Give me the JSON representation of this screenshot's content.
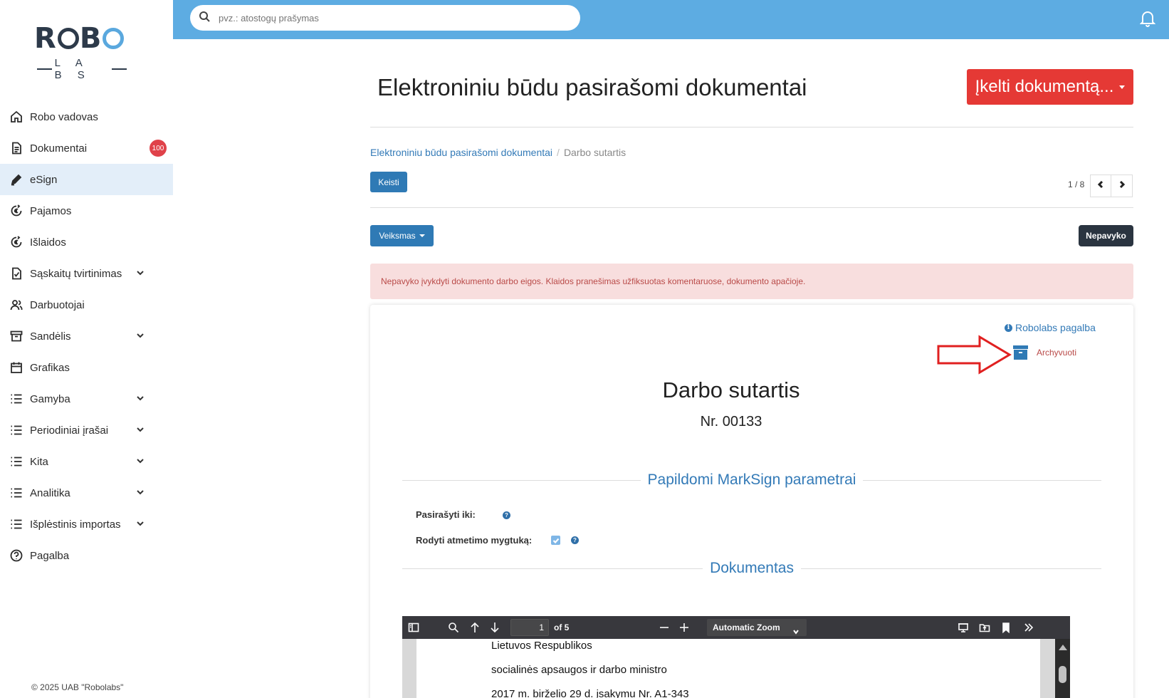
{
  "logo": {
    "top": "ROBO",
    "bottom": "LABS"
  },
  "sidebar": {
    "items": [
      {
        "label": "Robo vadovas",
        "icon": "home-icon"
      },
      {
        "label": "Dokumentai",
        "icon": "document-icon",
        "badge": "100"
      },
      {
        "label": "eSign",
        "icon": "pen-icon",
        "active": true
      },
      {
        "label": "Pajamos",
        "icon": "income-icon"
      },
      {
        "label": "Išlaidos",
        "icon": "expenses-icon"
      },
      {
        "label": "Sąskaitų tvirtinimas",
        "icon": "invoice-check-icon",
        "expandable": true
      },
      {
        "label": "Darbuotojai",
        "icon": "users-icon"
      },
      {
        "label": "Sandėlis",
        "icon": "archive-box-icon",
        "expandable": true
      },
      {
        "label": "Grafikas",
        "icon": "calendar-icon"
      },
      {
        "label": "Gamyba",
        "icon": "list-icon",
        "expandable": true
      },
      {
        "label": "Periodiniai įrašai",
        "icon": "list-icon",
        "expandable": true
      },
      {
        "label": "Kita",
        "icon": "list-icon",
        "expandable": true
      },
      {
        "label": "Analitika",
        "icon": "list-icon",
        "expandable": true
      },
      {
        "label": "Išplėstinis importas",
        "icon": "list-icon",
        "expandable": true
      },
      {
        "label": "Pagalba",
        "icon": "help-circle-icon"
      }
    ],
    "copyright": "© 2025 UAB \"Robolabs\""
  },
  "topbar": {
    "search_placeholder": "pvz.: atostogų prašymas"
  },
  "header": {
    "title": "Elektroniniu būdu pasirašomi dokumentai",
    "upload_button": "Įkelti dokumentą..."
  },
  "breadcrumb": {
    "parent": "Elektroniniu būdu pasirašomi dokumentai",
    "separator": "/",
    "current": "Darbo sutartis"
  },
  "toolbar": {
    "edit_button": "Keisti",
    "pager": "1 / 8",
    "action_button": "Veiksmas",
    "status_button": "Nepavyko"
  },
  "alert": {
    "text": "Nepavyko įvykdyti dokumento darbo eigos. Klaidos pranešimas užfiksuotas komentaruose, dokumento apačioje."
  },
  "document": {
    "help_link": "Robolabs pagalba",
    "archive_label": "Archyvuoti",
    "title": "Darbo sutartis",
    "number": "Nr. 00133",
    "section_params": "Papildomi MarkSign parametrai",
    "field_sign_until": "Pasirašyti iki:",
    "field_show_reject": "Rodyti atmetimo mygtuką:",
    "show_reject_checked": true,
    "section_document": "Dokumentas"
  },
  "pdf_viewer": {
    "page": "1",
    "of_pages": "of 5",
    "zoom": "Automatic Zoom",
    "lines": [
      "Lietuvos Respublikos",
      "socialinės apsaugos ir darbo ministro",
      "2017 m. birželio 29 d. įsakymu Nr. A1-343"
    ]
  },
  "colors": {
    "topbar": "#5dace2",
    "primary": "#2f7ab5",
    "danger": "#e53935",
    "alert_bg": "#f8dede"
  }
}
